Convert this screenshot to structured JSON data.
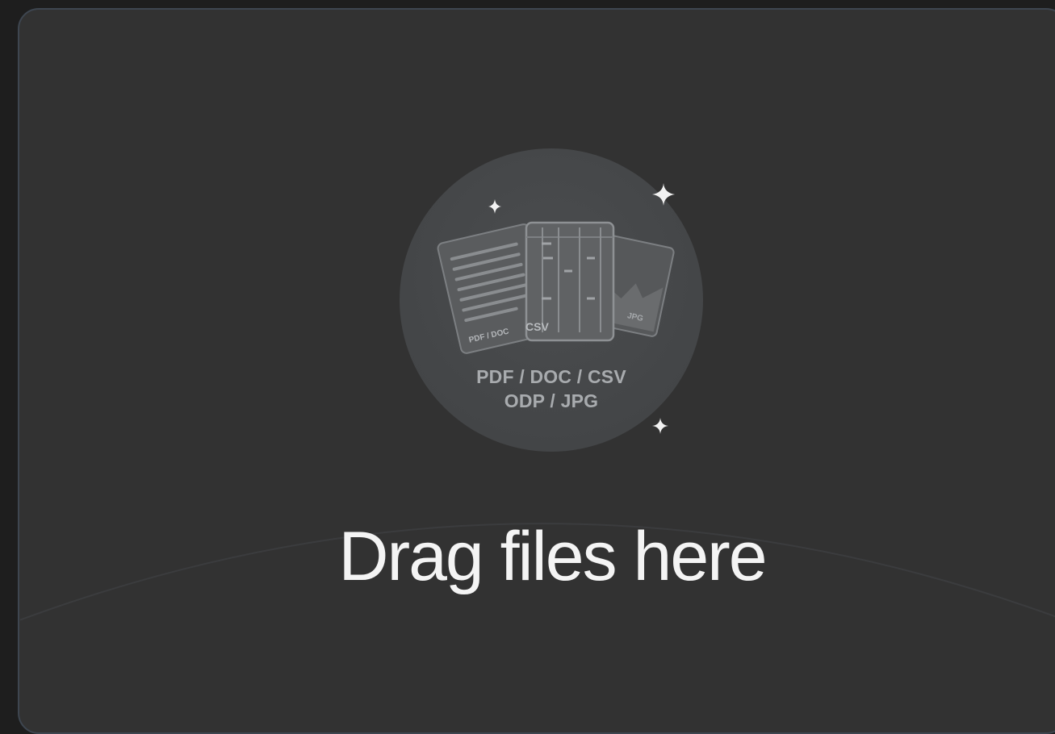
{
  "dropzone": {
    "title": "Drag files here",
    "formats_line1": "PDF / DOC / CSV",
    "formats_line2": "ODP / JPG",
    "doc_card_label": "PDF / DOC",
    "sheet_card_label": "CSV",
    "image_card_label": "JPG",
    "icons": [
      "document-icon",
      "spreadsheet-icon",
      "image-icon",
      "sparkle-icon"
    ]
  },
  "colors": {
    "page_background": "#1e1e1e",
    "panel_background": "#323232",
    "panel_border": "#3e4650",
    "badge_background": "#474949",
    "title_text": "#f4f4f4",
    "format_text": "#a8abae"
  }
}
